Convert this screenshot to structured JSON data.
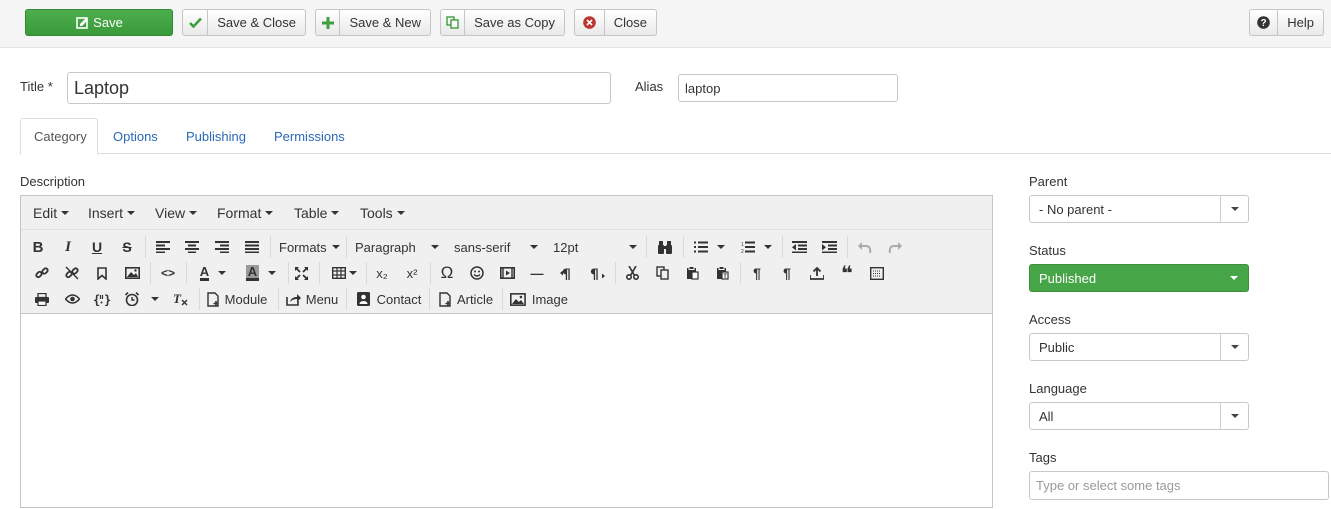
{
  "toolbar": {
    "save": "Save",
    "save_close": "Save & Close",
    "save_new": "Save & New",
    "save_copy": "Save as Copy",
    "close": "Close",
    "help": "Help"
  },
  "fields": {
    "title_label": "Title *",
    "title_value": "Laptop",
    "alias_label": "Alias",
    "alias_value": "laptop"
  },
  "tabs": [
    "Category",
    "Options",
    "Publishing",
    "Permissions"
  ],
  "editor": {
    "description_label": "Description",
    "menus": [
      "Edit",
      "Insert",
      "View",
      "Format",
      "Table",
      "Tools"
    ],
    "formats_label": "Formats",
    "block_format": "Paragraph",
    "font_family": "sans-serif",
    "font_size": "12pt",
    "buttons": {
      "module": "Module",
      "menu": "Menu",
      "contact": "Contact",
      "article": "Article",
      "image": "Image"
    },
    "glyphs": {
      "bold": "B",
      "italic": "I",
      "underline": "U",
      "strike": "S",
      "code": "<>",
      "text_color": "A",
      "bg_color": "A",
      "subscript": "x₂",
      "superscript": "x²",
      "omega": "Ω",
      "hr": "—",
      "quote": "❝",
      "show_blocks": "¶",
      "ltr": "¶",
      "rtl": "¶"
    }
  },
  "sidebar": {
    "parent_label": "Parent",
    "parent_value": "- No parent -",
    "status_label": "Status",
    "status_value": "Published",
    "access_label": "Access",
    "access_value": "Public",
    "language_label": "Language",
    "language_value": "All",
    "tags_label": "Tags",
    "tags_placeholder": "Type or select some tags"
  },
  "colors": {
    "save_green": "#3fa33f",
    "status_green": "#46a546",
    "link_blue": "#2a69b8",
    "close_red": "#bd362f"
  }
}
